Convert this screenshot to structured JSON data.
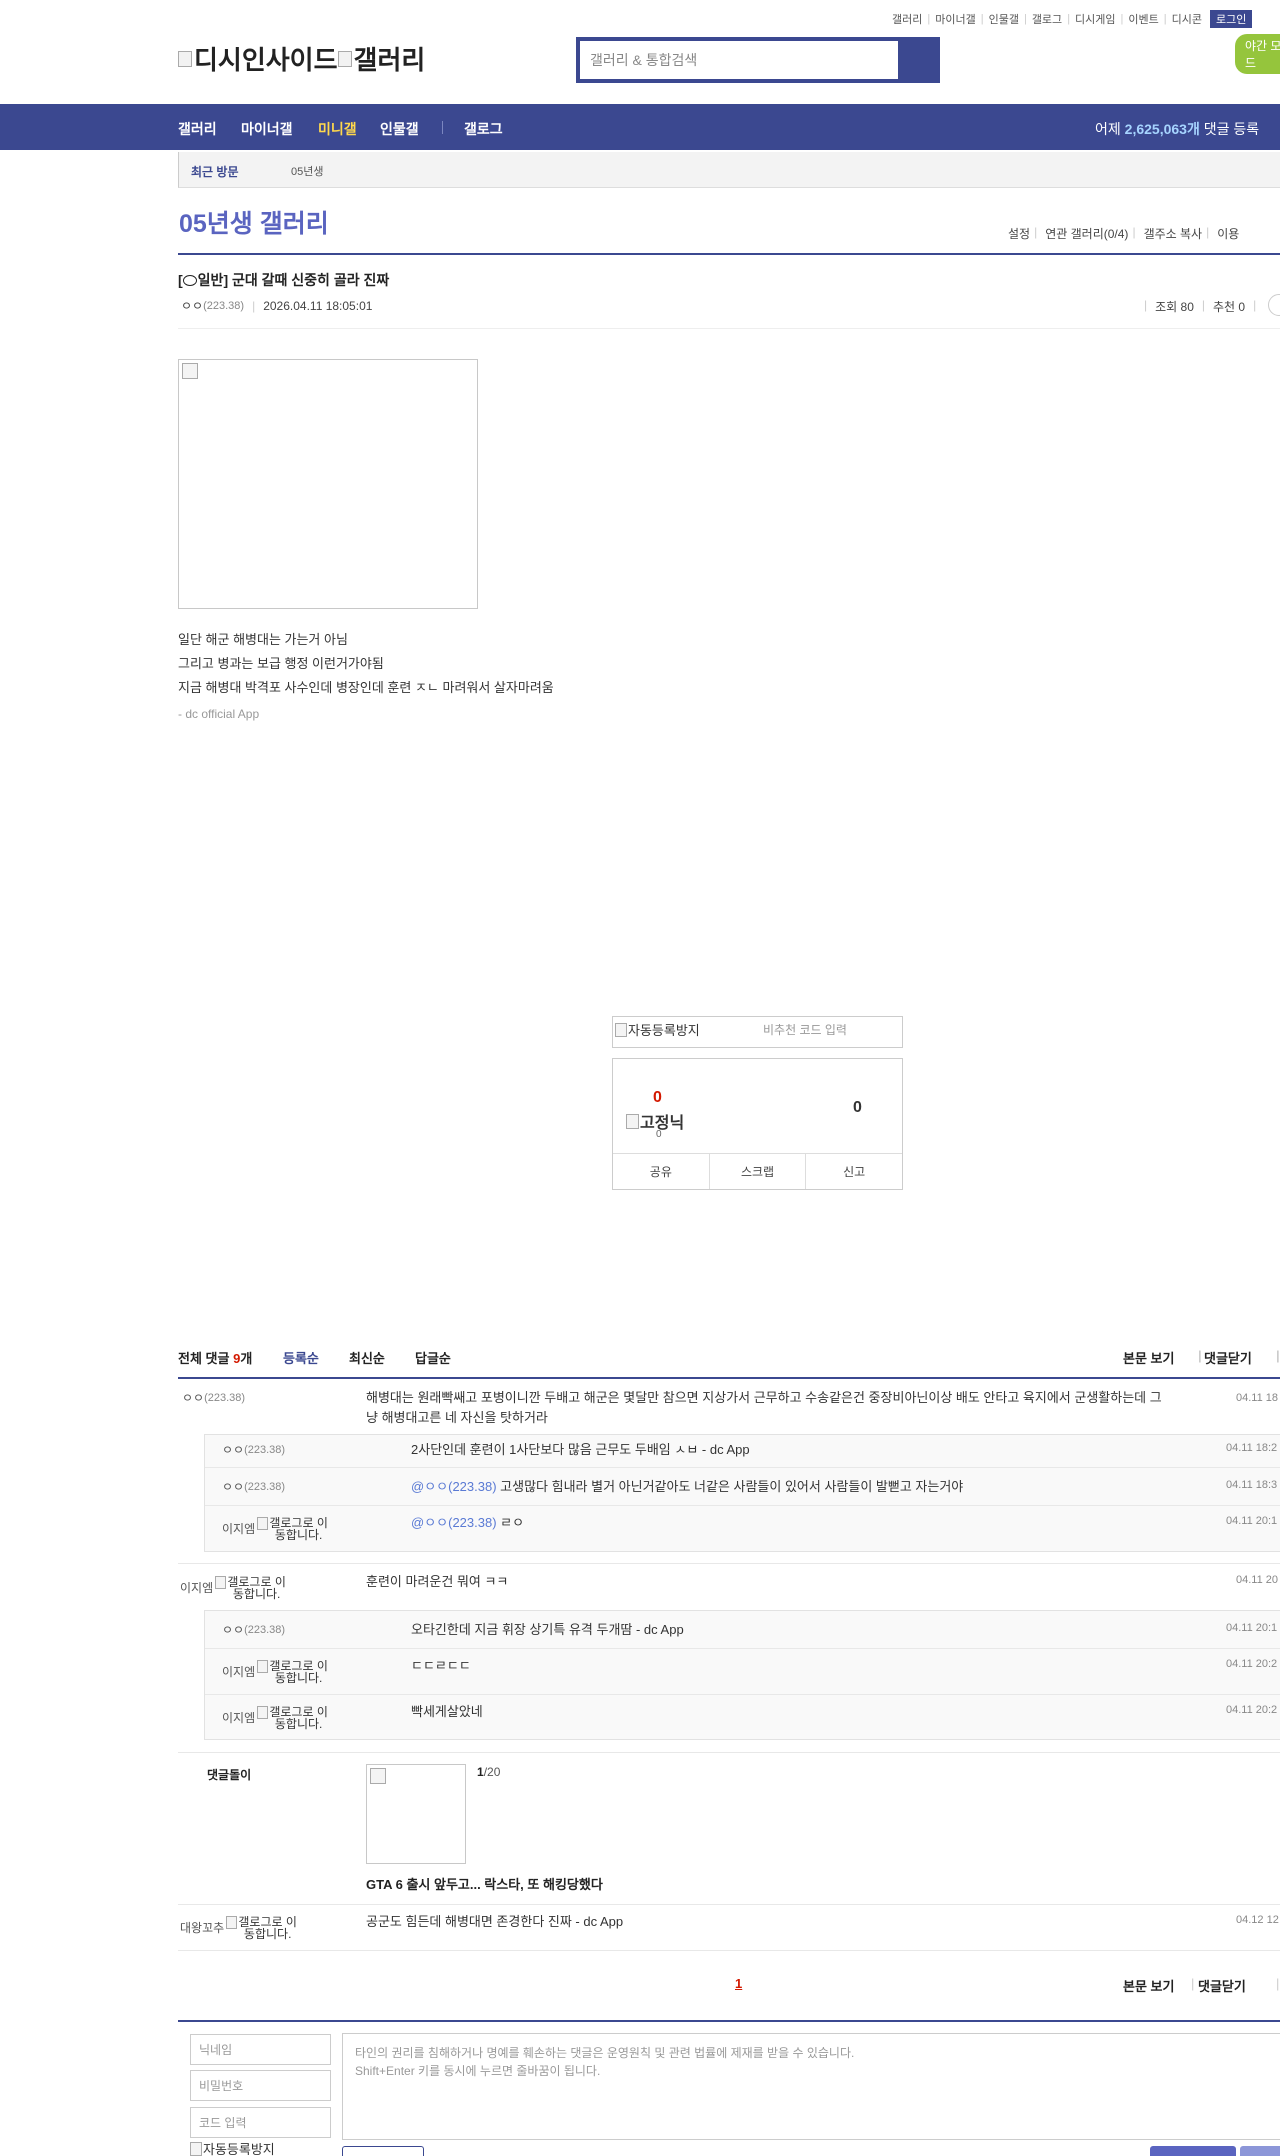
{
  "util_nav": [
    "갤러리",
    "마이너갤",
    "인물갤",
    "갤로그",
    "디시게임",
    "이벤트",
    "디시콘"
  ],
  "login": "로그인",
  "night_mode": "야간 모드",
  "logo": {
    "site": "디시인사이드",
    "gallery": "갤러리"
  },
  "search": {
    "placeholder": "갤러리 & 통합검색"
  },
  "nav": {
    "items": [
      "갤러리",
      "마이너갤",
      "미니갤",
      "인물갤",
      "갤로그"
    ],
    "active": "미니갤",
    "stat_prefix": "어제",
    "stat_count": "2,625,063개",
    "stat_suffix": "댓글 등록"
  },
  "recent": {
    "label": "최근 방문",
    "gallery": "05년생"
  },
  "gallery": {
    "title": "05년생 갤러리",
    "menu": [
      "설정",
      "연관 갤러리(0/4)",
      "갤주소 복사",
      "이용"
    ]
  },
  "post": {
    "title_prefix": "[",
    "title_icon_label": "일반",
    "title": "] 군대 갈때 신중히 골라 진짜",
    "author": "ㅇㅇ",
    "ip": "(223.38)",
    "datetime": "2026.04.11 18:05:01",
    "views": "조회 80",
    "recommend": "추천 0",
    "body": [
      "일단 해군 해병대는 가는거 아님",
      "그리고 병과는 보급 행정 이런거가야됨",
      "지금 해병대 박격포 사수인데 병장인데 훈련 ㅈㄴ 마려워서 살자마려움"
    ],
    "signature": "- dc official App"
  },
  "captcha": {
    "image_alt": "자동등록방지",
    "placeholder": "비추천 코드 입력"
  },
  "recommend_box": {
    "up": "0",
    "fixed_label": "고정닉",
    "fixed_count": "0",
    "down": "0",
    "buttons": [
      "공유",
      "스크랩",
      "신고"
    ]
  },
  "comments_header": {
    "total_label": "전체 댓글",
    "total_count": "9",
    "total_unit": "개",
    "sort": [
      "등록순",
      "최신순",
      "답글순"
    ],
    "actions": [
      "본문 보기",
      "댓글닫기"
    ]
  },
  "comments": [
    {
      "nick": "ㅇㅇ",
      "ip": "(223.38)",
      "text": "해병대는 원래빡쌔고 포병이니깐 두배고 해군은 몇달만 참으면 지상가서 근무하고 수송같은건 중장비아닌이상 배도 안타고 육지에서 군생활하는데 그냥 해병대고른 네 자신을 탓하거라",
      "date": "04.11 18"
    },
    {
      "nick": "ㅇㅇ",
      "ip": "(223.38)",
      "text": "2사단인데 훈련이 1사단보다 많음 근무도 두배임 ㅅㅂ - dc App",
      "date": "04.11 18:2"
    },
    {
      "nick": "ㅇㅇ",
      "ip": "(223.38)",
      "mention": "@ㅇㅇ(223.38)",
      "text": "고생많다 힘내라 별거 아닌거같아도 너같은 사람들이 있어서 사람들이 발뻗고 자는거야",
      "date": "04.11 18:3"
    },
    {
      "nick": "이지엠",
      "gallog_alt": "갤로그로 이동합니다.",
      "mention": "@ㅇㅇ(223.38)",
      "text": "ㄹㅇ",
      "date": "04.11 20:1"
    },
    {
      "nick": "이지엠",
      "gallog_alt": "갤로그로 이동합니다.",
      "text": "훈련이 마려운건 뭐여 ㅋㅋ",
      "date": "04.11 20"
    },
    {
      "nick": "ㅇㅇ",
      "ip": "(223.38)",
      "text": "오타긴한데 지금 휘장 상기특 유격 두개땀 - dc App",
      "date": "04.11 20:1"
    },
    {
      "nick": "이지엠",
      "gallog_alt": "갤로그로 이동합니다.",
      "text": "ㄷㄷㄹㄷㄷ",
      "date": "04.11 20:2"
    },
    {
      "nick": "이지엠",
      "gallog_alt": "갤로그로 이동합니다.",
      "text": "빡세게살았네",
      "date": "04.11 20:2"
    },
    {
      "nick": "대왕꼬추",
      "gallog_alt": "갤로그로 이동합니다.",
      "text": "공군도 힘든데 해병대면 존경한다 진짜 - dc App",
      "date": "04.12 12"
    }
  ],
  "dcbot": {
    "label": "댓글돌이",
    "page_current": "1",
    "page_total": "/20",
    "headline": "GTA 6 출시 앞두고... 락스타, 또 해킹당했다"
  },
  "pagination": {
    "current": "1"
  },
  "write": {
    "nickname_placeholder": "닉네임",
    "password_placeholder": "비밀번호",
    "code_placeholder": "코드 입력",
    "captcha_alt": "자동등록방지",
    "notice_line1": "타인의 권리를 침해하거나 명예를 훼손하는 댓글은 운영원칙 및 관련 법률에 제재를 받을 수 있습니다.",
    "notice_line2": "Shift+Enter 키를 동시에 누르면 줄바꿈이 됩니다."
  }
}
